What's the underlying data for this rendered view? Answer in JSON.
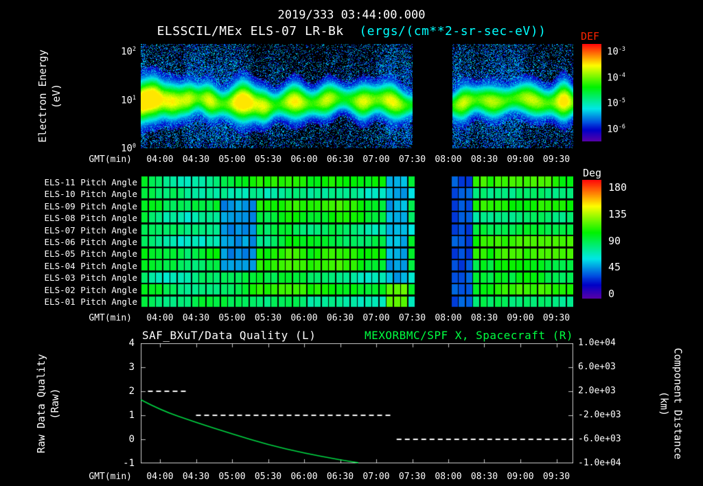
{
  "header": {
    "timestamp": "2019/333 03:44:00.000",
    "instrument_title": "ELSSCIL/MEx ELS-07 LR-Bk",
    "units_title": "(ergs/(cm**2-sr-sec-eV))"
  },
  "colors": {
    "background": "#000000",
    "text": "#ffffff",
    "units_cyan": "#00ffff",
    "def_label_red": "#ff2400",
    "right_title_green": "#00ff41",
    "distance_curve_green": "#00d944",
    "quality_series_white": "#ffffff"
  },
  "time_axis": {
    "label": "GMT(min)",
    "start": "03:44",
    "end": "09:44",
    "duration_min": 360,
    "tick_start_min": 16,
    "tick_step_min": 30,
    "ticks": [
      "04:00",
      "04:30",
      "05:00",
      "05:30",
      "06:00",
      "06:30",
      "07:00",
      "07:30",
      "08:00",
      "08:30",
      "09:00",
      "09:30"
    ]
  },
  "chart_data": [
    {
      "id": "electron_energy_spectrogram",
      "type": "heatmap",
      "xlabel": "GMT(min)",
      "ylabel_lines": [
        "Electron Energy",
        "(eV)"
      ],
      "y_scale": "log",
      "y_range_ev": [
        1,
        145
      ],
      "y_tick_exponents": [
        0,
        1,
        2
      ],
      "colorbar": {
        "label": "DEF",
        "units": "ergs/(cm**2-sr-sec-eV)",
        "tick_exponents": [
          -3,
          -4,
          -5,
          -6
        ],
        "range": [
          1e-06,
          0.001
        ],
        "palette": "rainbow"
      },
      "data_gap_min": [
        226,
        259
      ],
      "band": {
        "center_ev": 9,
        "half_width_decades": 0.16,
        "base_level": 0.5
      },
      "enhancements": [
        {
          "t_min": 2,
          "width_min": 4,
          "strength": 0.85
        },
        {
          "t_min": 10,
          "width_min": 6,
          "strength": 0.95
        },
        {
          "t_min": 26,
          "width_min": 7,
          "strength": 0.7
        },
        {
          "t_min": 40,
          "width_min": 5,
          "strength": 0.5
        },
        {
          "t_min": 57,
          "width_min": 6,
          "strength": 0.65
        },
        {
          "t_min": 85,
          "width_min": 9,
          "strength": 1.0
        },
        {
          "t_min": 103,
          "width_min": 5,
          "strength": 0.5
        },
        {
          "t_min": 128,
          "width_min": 8,
          "strength": 0.75
        },
        {
          "t_min": 155,
          "width_min": 7,
          "strength": 0.6
        },
        {
          "t_min": 185,
          "width_min": 7,
          "strength": 0.65
        },
        {
          "t_min": 209,
          "width_min": 8,
          "strength": 0.7
        },
        {
          "t_min": 268,
          "width_min": 6,
          "strength": 0.6
        },
        {
          "t_min": 292,
          "width_min": 9,
          "strength": 0.55
        },
        {
          "t_min": 325,
          "width_min": 10,
          "strength": 0.6
        },
        {
          "t_min": 352,
          "width_min": 6,
          "strength": 0.85
        }
      ],
      "noise_seed": 1333
    },
    {
      "id": "pitch_angle_panel",
      "type": "heatmap",
      "xlabel": "GMT(min)",
      "rows": [
        "ELS-11 Pitch Angle",
        "ELS-10 Pitch Angle",
        "ELS-09 Pitch Angle",
        "ELS-08 Pitch Angle",
        "ELS-07 Pitch Angle",
        "ELS-06 Pitch Angle",
        "ELS-05 Pitch Angle",
        "ELS-04 Pitch Angle",
        "ELS-03 Pitch Angle",
        "ELS-02 Pitch Angle",
        "ELS-01 Pitch Angle"
      ],
      "colorbar": {
        "label": "Deg",
        "ticks": [
          180,
          135,
          90,
          45,
          0
        ],
        "range": [
          0,
          180
        ],
        "palette": "rainbow"
      },
      "base_value_deg": 88,
      "cell_minutes": 6,
      "data_gap_min": [
        226,
        259
      ],
      "features": [
        {
          "t_min": [
            68,
            95
          ],
          "row_indexes": [
            2,
            3,
            4,
            5,
            6,
            7
          ],
          "value_deg": 46
        },
        {
          "t_min": [
            203,
            224
          ],
          "row_indexes": [
            0,
            1,
            2,
            3,
            4,
            5,
            6,
            7,
            8
          ],
          "value_deg": 50
        },
        {
          "t_min": [
            203,
            222
          ],
          "row_indexes": [
            9,
            10
          ],
          "value_deg": 117
        },
        {
          "t_min": [
            259,
            273
          ],
          "row_indexes": [
            0,
            1,
            2,
            3,
            4,
            5,
            6,
            7,
            8,
            9,
            10
          ],
          "value_deg": 34
        }
      ],
      "noise_seed": 777
    },
    {
      "id": "quality_and_distance",
      "type": "line",
      "xlabel": "GMT(min)",
      "title_left": "SAF_BXuT/Data Quality (L)",
      "title_right": "MEXORBMC/SPF X, Spacecraft (R)",
      "left_axis": {
        "label_lines": [
          "Raw Data Quality",
          "(Raw)"
        ],
        "range": [
          -1,
          4
        ],
        "ticks": [
          4,
          3,
          2,
          1,
          0,
          -1
        ]
      },
      "right_axis": {
        "label_lines": [
          "Component Distance",
          "(km)"
        ],
        "range": [
          -10000,
          10000
        ],
        "ticks": [
          "1.0e+04",
          "6.0e+03",
          "2.0e+03",
          "-2.0e+03",
          "-6.0e+03",
          "-1.0e+04"
        ]
      },
      "series": [
        {
          "name": "Raw Data Quality",
          "axis": "left",
          "style": "dashed",
          "color": "#ffffff",
          "segments": [
            {
              "value": 2,
              "t_min": [
                6,
                38
              ]
            },
            {
              "value": 1,
              "t_min": [
                46,
                208
              ]
            },
            {
              "value": 0,
              "t_min": [
                213,
                360
              ]
            }
          ]
        },
        {
          "name": "Spacecraft X Component Distance",
          "axis": "right",
          "style": "solid",
          "color": "#00d944",
          "points_t_min_km": [
            [
              0,
              600
            ],
            [
              16,
              -1100
            ],
            [
              46,
              -3200
            ],
            [
              76,
              -5100
            ],
            [
              106,
              -6900
            ],
            [
              136,
              -8300
            ],
            [
              166,
              -9400
            ],
            [
              181,
              -9900
            ]
          ]
        }
      ]
    }
  ]
}
